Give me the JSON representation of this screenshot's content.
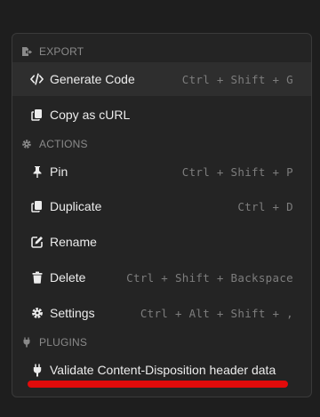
{
  "menu": {
    "sections": {
      "export": {
        "title": "EXPORT",
        "icon": "file-export-icon"
      },
      "actions": {
        "title": "ACTIONS",
        "icon": "gear-icon"
      },
      "plugins": {
        "title": "PLUGINS",
        "icon": "plug-icon"
      }
    },
    "items": {
      "generate_code": {
        "label": "Generate Code",
        "shortcut": "Ctrl + Shift + G",
        "icon": "code-icon"
      },
      "copy_as_curl": {
        "label": "Copy as cURL",
        "shortcut": "",
        "icon": "copy-icon"
      },
      "pin": {
        "label": "Pin",
        "shortcut": "Ctrl + Shift + P",
        "icon": "pin-icon"
      },
      "duplicate": {
        "label": "Duplicate",
        "shortcut": "Ctrl + D",
        "icon": "copy-icon"
      },
      "rename": {
        "label": "Rename",
        "shortcut": "",
        "icon": "edit-icon"
      },
      "delete": {
        "label": "Delete",
        "shortcut": "Ctrl + Shift + Backspace",
        "icon": "trash-icon"
      },
      "settings": {
        "label": "Settings",
        "shortcut": "Ctrl + Alt + Shift + ,",
        "icon": "gear-icon"
      },
      "validate_content_disposition": {
        "label": "Validate Content-Disposition header data",
        "shortcut": "",
        "icon": "plug-icon"
      }
    }
  },
  "colors": {
    "background": "#1e1e1e",
    "menu_background": "#242424",
    "hover_background": "#2e2e2e",
    "annotation_underline": "#e10b0b"
  }
}
